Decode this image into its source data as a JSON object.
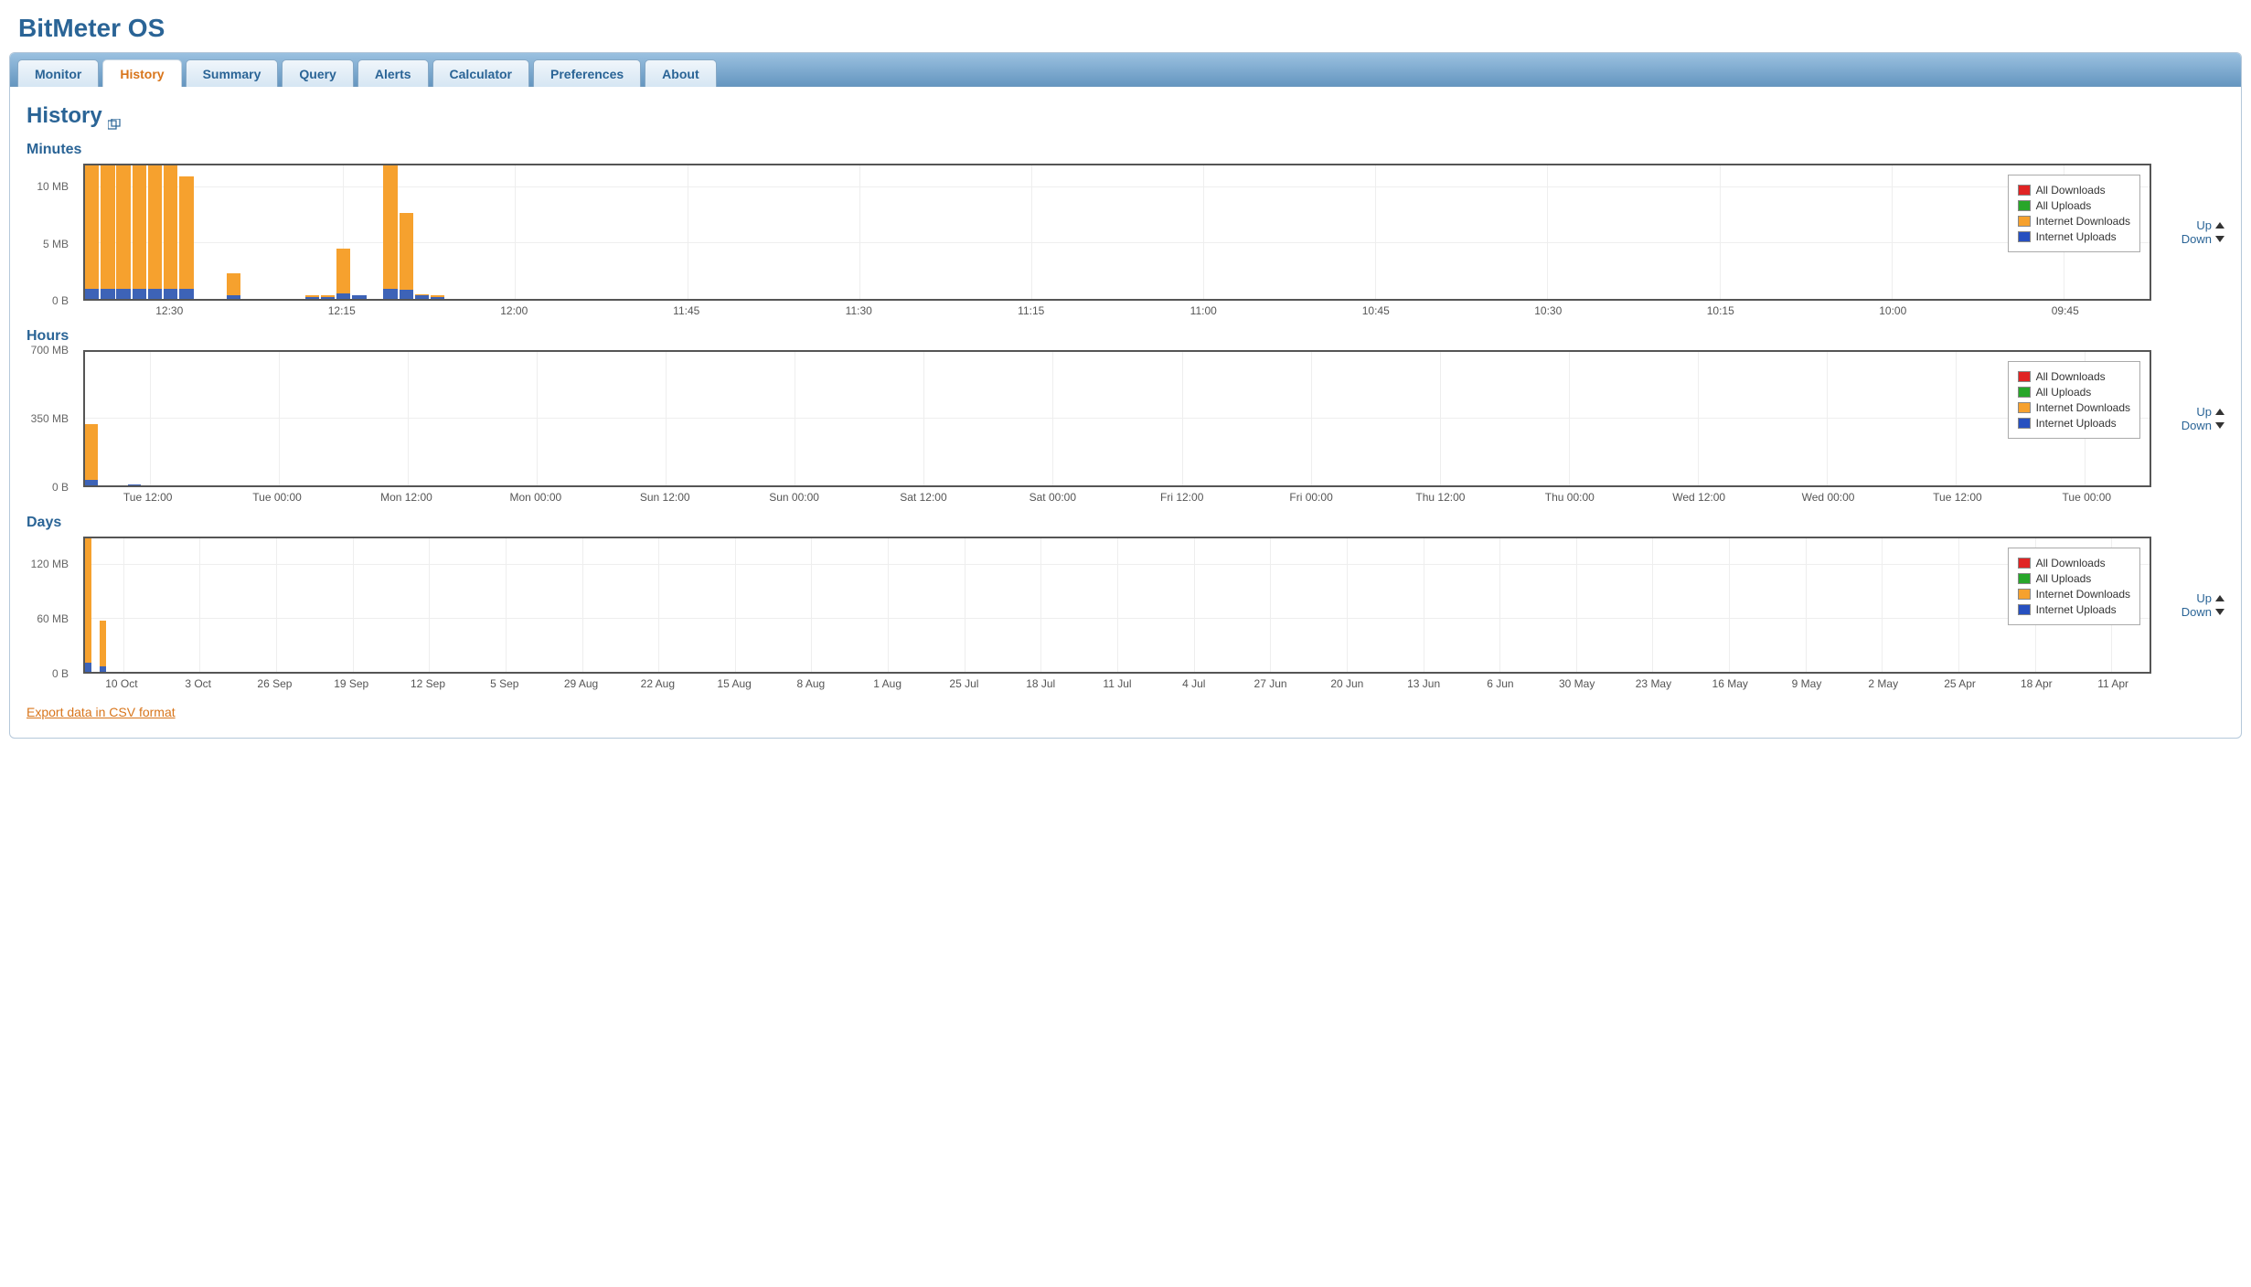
{
  "app_title": "BitMeter OS",
  "tabs": [
    "Monitor",
    "History",
    "Summary",
    "Query",
    "Alerts",
    "Calculator",
    "Preferences",
    "About"
  ],
  "active_tab": 1,
  "page_title": "History",
  "export_link": "Export data in CSV format",
  "legend": {
    "all_downloads": "All Downloads",
    "all_uploads": "All Uploads",
    "internet_downloads": "Internet Downloads",
    "internet_uploads": "Internet Uploads",
    "colors": {
      "all_downloads": "#e02424",
      "all_uploads": "#28a62a",
      "internet_downloads": "#f6a12e",
      "internet_uploads": "#2750c0"
    }
  },
  "controls": {
    "up": "Up",
    "down": "Down"
  },
  "sections": {
    "minutes": {
      "title": "Minutes"
    },
    "hours": {
      "title": "Hours"
    },
    "days": {
      "title": "Days"
    }
  },
  "chart_data": [
    {
      "id": "minutes",
      "type": "bar",
      "ylabel_unit": "MB",
      "ylim": [
        0,
        12
      ],
      "yticks": [
        {
          "v": 0,
          "label": "0 B"
        },
        {
          "v": 5,
          "label": "5 MB"
        },
        {
          "v": 10,
          "label": "10 MB"
        }
      ],
      "xticks": [
        "12:30",
        "12:15",
        "12:00",
        "11:45",
        "11:30",
        "11:15",
        "11:00",
        "10:45",
        "10:30",
        "10:15",
        "10:00",
        "09:45"
      ],
      "series": [
        {
          "name": "Internet Downloads",
          "color": "#f6a12e",
          "values": [
            12,
            12,
            12,
            12,
            12,
            12,
            11,
            0,
            0,
            2.3,
            0,
            0,
            0,
            0,
            0.3,
            0.3,
            4.5,
            0.3,
            0,
            12,
            7.7,
            0.4,
            0.3
          ]
        },
        {
          "name": "Internet Uploads",
          "color": "#3d63b7",
          "values": [
            0.9,
            0.9,
            0.9,
            0.9,
            0.9,
            0.9,
            0.9,
            0,
            0,
            0.3,
            0,
            0,
            0,
            0,
            0.2,
            0.2,
            0.5,
            0.3,
            0,
            0.9,
            0.8,
            0.3,
            0.2
          ]
        }
      ],
      "bar_area_fraction": 0.175
    },
    {
      "id": "hours",
      "type": "bar",
      "ylabel_unit": "MB",
      "ylim": [
        0,
        700
      ],
      "yticks": [
        {
          "v": 0,
          "label": "0 B"
        },
        {
          "v": 350,
          "label": "350 MB"
        },
        {
          "v": 700,
          "label": "700 MB"
        }
      ],
      "xticks": [
        "Tue 12:00",
        "Tue 00:00",
        "Mon 12:00",
        "Mon 00:00",
        "Sun 12:00",
        "Sun 00:00",
        "Sat 12:00",
        "Sat 00:00",
        "Fri 12:00",
        "Fri 00:00",
        "Thu 12:00",
        "Thu 00:00",
        "Wed 12:00",
        "Wed 00:00",
        "Tue 12:00",
        "Tue 00:00"
      ],
      "series": [
        {
          "name": "Internet Downloads",
          "color": "#f6a12e",
          "values": [
            320,
            0,
            0,
            0,
            0,
            0,
            0,
            0,
            0,
            0,
            0,
            0,
            0,
            0,
            0,
            0
          ]
        },
        {
          "name": "Internet Uploads",
          "color": "#3d63b7",
          "values": [
            30,
            0,
            0,
            7,
            0,
            0,
            0,
            0,
            0,
            0,
            0,
            0,
            0,
            0,
            0,
            0
          ]
        }
      ],
      "bar_area_fraction": 0.11
    },
    {
      "id": "days",
      "type": "bar",
      "ylabel_unit": "MB",
      "ylim": [
        0,
        150
      ],
      "yticks": [
        {
          "v": 0,
          "label": "0 B"
        },
        {
          "v": 60,
          "label": "60 MB"
        },
        {
          "v": 120,
          "label": "120 MB"
        }
      ],
      "xticks": [
        "10 Oct",
        "3 Oct",
        "26 Sep",
        "19 Sep",
        "12 Sep",
        "5 Sep",
        "29 Aug",
        "22 Aug",
        "15 Aug",
        "8 Aug",
        "1 Aug",
        "25 Jul",
        "18 Jul",
        "11 Jul",
        "4 Jul",
        "27 Jun",
        "20 Jun",
        "13 Jun",
        "6 Jun",
        "30 May",
        "23 May",
        "16 May",
        "9 May",
        "2 May",
        "25 Apr",
        "18 Apr",
        "11 Apr"
      ],
      "series": [
        {
          "name": "Internet Downloads",
          "color": "#f6a12e",
          "values": [
            150,
            0,
            58,
            0,
            0,
            0,
            0,
            0,
            0,
            0,
            0,
            0,
            0,
            0,
            0,
            0,
            0,
            0,
            0,
            0,
            0,
            0,
            0,
            0,
            0,
            0,
            0
          ]
        },
        {
          "name": "Internet Uploads",
          "color": "#3d63b7",
          "values": [
            10,
            0,
            6,
            0,
            0,
            0,
            0,
            0,
            0,
            0,
            0,
            0,
            0,
            0,
            0,
            0,
            0,
            0,
            0,
            0,
            0,
            0,
            0,
            0,
            0,
            0,
            0
          ]
        }
      ],
      "bar_area_fraction": 0.095
    }
  ]
}
